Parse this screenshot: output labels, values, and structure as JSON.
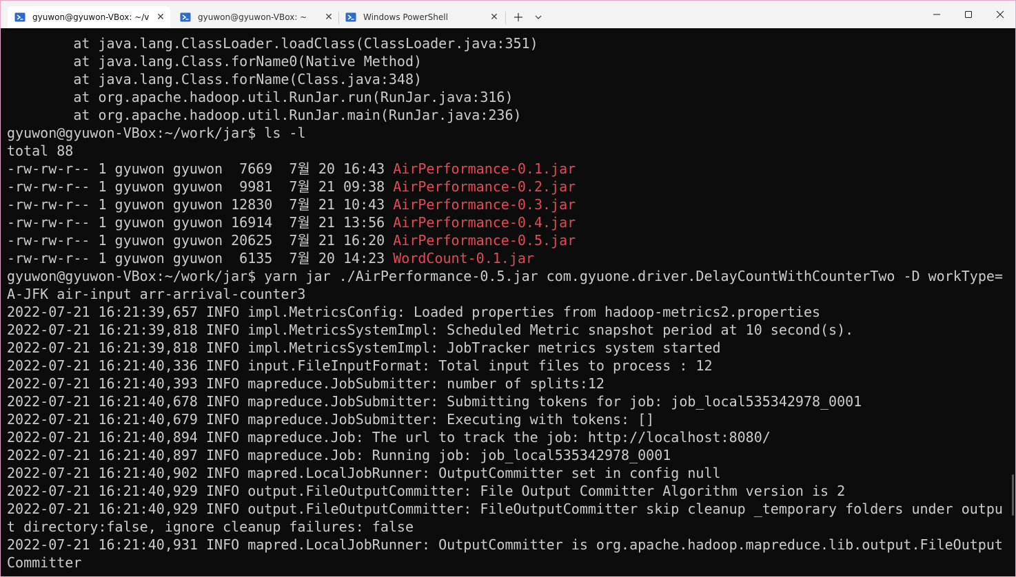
{
  "tabs": [
    {
      "label": "gyuwon@gyuwon-VBox: ~/v",
      "active": true
    },
    {
      "label": "gyuwon@gyuwon-VBox: ~",
      "active": false
    },
    {
      "label": "Windows PowerShell",
      "active": false
    }
  ],
  "icons": {
    "tab_icon": "powershell-icon",
    "close": "close-icon",
    "new_tab": "plus-icon",
    "dropdown": "chevron-down-icon",
    "minimize": "minimize-icon",
    "maximize": "maximize-icon",
    "window_close": "close-icon"
  },
  "colors": {
    "terminal_bg": "#0c0c0c",
    "text": "#cccccc",
    "archive": "#e74856",
    "titlebar": "#f3f3f3"
  },
  "terminal": {
    "lines": [
      "        at java.lang.ClassLoader.loadClass(ClassLoader.java:351)",
      "        at java.lang.Class.forName0(Native Method)",
      "        at java.lang.Class.forName(Class.java:348)",
      "        at org.apache.hadoop.util.RunJar.run(RunJar.java:316)",
      "        at org.apache.hadoop.util.RunJar.main(RunJar.java:236)"
    ],
    "prompt_user": "gyuwon@gyuwon-VBox",
    "prompt_path": ":~/work/jar$",
    "cmd1": " ls -l",
    "total": "total 88",
    "ls_rows": [
      {
        "meta": "-rw-rw-r-- 1 gyuwon gyuwon  7669  7월 20 16:43 ",
        "file": "AirPerformance-0.1.jar"
      },
      {
        "meta": "-rw-rw-r-- 1 gyuwon gyuwon  9981  7월 21 09:38 ",
        "file": "AirPerformance-0.2.jar"
      },
      {
        "meta": "-rw-rw-r-- 1 gyuwon gyuwon 12830  7월 21 10:43 ",
        "file": "AirPerformance-0.3.jar"
      },
      {
        "meta": "-rw-rw-r-- 1 gyuwon gyuwon 16914  7월 21 13:56 ",
        "file": "AirPerformance-0.4.jar"
      },
      {
        "meta": "-rw-rw-r-- 1 gyuwon gyuwon 20625  7월 21 16:20 ",
        "file": "AirPerformance-0.5.jar"
      },
      {
        "meta": "-rw-rw-r-- 1 gyuwon gyuwon  6135  7월 20 14:23 ",
        "file": "WordCount-0.1.jar"
      }
    ],
    "cmd2": " yarn jar ./AirPerformance-0.5.jar com.gyuone.driver.DelayCountWithCounterTwo -D workType=",
    "cmd2_cont": "A-JFK air-input arr-arrival-counter3",
    "log": [
      "2022-07-21 16:21:39,657 INFO impl.MetricsConfig: Loaded properties from hadoop-metrics2.properties",
      "2022-07-21 16:21:39,818 INFO impl.MetricsSystemImpl: Scheduled Metric snapshot period at 10 second(s).",
      "2022-07-21 16:21:39,818 INFO impl.MetricsSystemImpl: JobTracker metrics system started",
      "2022-07-21 16:21:40,336 INFO input.FileInputFormat: Total input files to process : 12",
      "2022-07-21 16:21:40,393 INFO mapreduce.JobSubmitter: number of splits:12",
      "2022-07-21 16:21:40,678 INFO mapreduce.JobSubmitter: Submitting tokens for job: job_local535342978_0001",
      "2022-07-21 16:21:40,679 INFO mapreduce.JobSubmitter: Executing with tokens: []",
      "2022-07-21 16:21:40,894 INFO mapreduce.Job: The url to track the job: http://localhost:8080/",
      "2022-07-21 16:21:40,897 INFO mapreduce.Job: Running job: job_local535342978_0001",
      "2022-07-21 16:21:40,902 INFO mapred.LocalJobRunner: OutputCommitter set in config null",
      "2022-07-21 16:21:40,929 INFO output.FileOutputCommitter: File Output Committer Algorithm version is 2",
      "2022-07-21 16:21:40,929 INFO output.FileOutputCommitter: FileOutputCommitter skip cleanup _temporary folders under outpu",
      "t directory:false, ignore cleanup failures: false",
      "2022-07-21 16:21:40,931 INFO mapred.LocalJobRunner: OutputCommitter is org.apache.hadoop.mapreduce.lib.output.FileOutput",
      "Committer"
    ]
  }
}
